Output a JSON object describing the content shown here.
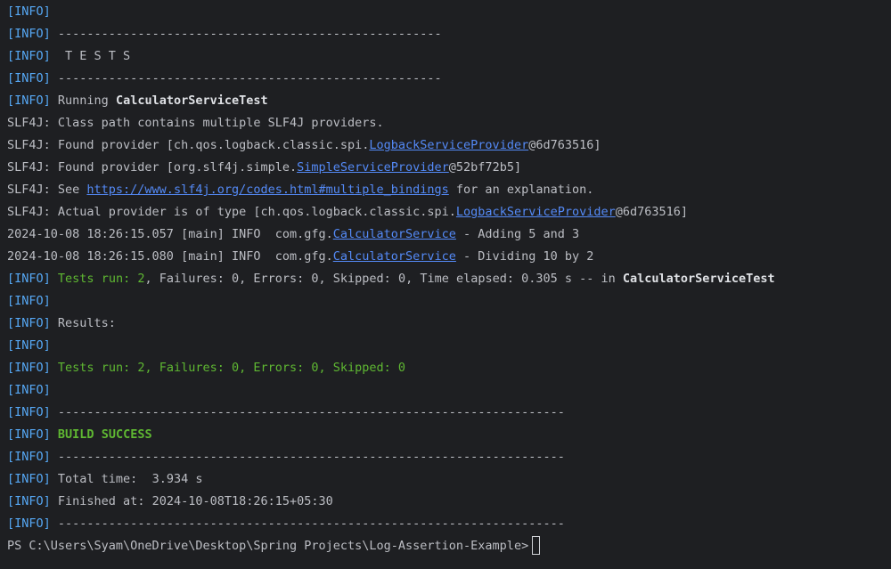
{
  "tag": "[INFO]",
  "lines": {
    "l1": "",
    "l2": " -----------------------------------------------------",
    "l3": "  T E S T S",
    "l4": " -----------------------------------------------------",
    "l5_pre": " Running ",
    "l5_class": "CalculatorServiceTest",
    "l6": "SLF4J: Class path contains multiple SLF4J providers.",
    "l7_pre": "SLF4J: Found provider [ch.qos.logback.classic.spi.",
    "l7_link": "LogbackServiceProvider",
    "l7_post": "@6d763516]",
    "l8_pre": "SLF4J: Found provider [org.slf4j.simple.",
    "l8_link": "SimpleServiceProvider",
    "l8_post": "@52bf72b5]",
    "l9_pre": "SLF4J: See ",
    "l9_link": "https://www.slf4j.org/codes.html#multiple_bindings",
    "l9_post": " for an explanation.",
    "l10_pre": "SLF4J: Actual provider is of type [ch.qos.logback.classic.spi.",
    "l10_link": "LogbackServiceProvider",
    "l10_post": "@6d763516]",
    "l11_pre": "2024-10-08 18:26:15.057 [main] INFO  com.gfg.",
    "l11_link": "CalculatorService",
    "l11_post": " - Adding 5 and 3",
    "l12_pre": "2024-10-08 18:26:15.080 [main] INFO  com.gfg.",
    "l12_link": "CalculatorService",
    "l12_post": " - Dividing 10 by 2",
    "l13_green": "Tests run: 2",
    "l13_mid": ", Failures: 0, Errors: 0, Skipped: 0, Time elapsed: 0.305 s -- in ",
    "l13_class": "CalculatorServiceTest",
    "l14": "",
    "l15": " Results:",
    "l16": "",
    "l17_green": "Tests run: 2, Failures: 0, Errors: 0, Skipped: 0",
    "l18": "",
    "l19": " ----------------------------------------------------------------------",
    "l20_green": "BUILD SUCCESS",
    "l21": " ----------------------------------------------------------------------",
    "l22": " Total time:  3.934 s",
    "l23": " Finished at: 2024-10-08T18:26:15+05:30",
    "l24": " ----------------------------------------------------------------------",
    "prompt": "PS C:\\Users\\Syam\\OneDrive\\Desktop\\Spring Projects\\Log-Assertion-Example>"
  },
  "colors": {
    "background": "#1e1f22",
    "text": "#bcbec4",
    "info_tag": "#56a8f5",
    "success_green": "#5fb832",
    "link": "#548af7"
  }
}
